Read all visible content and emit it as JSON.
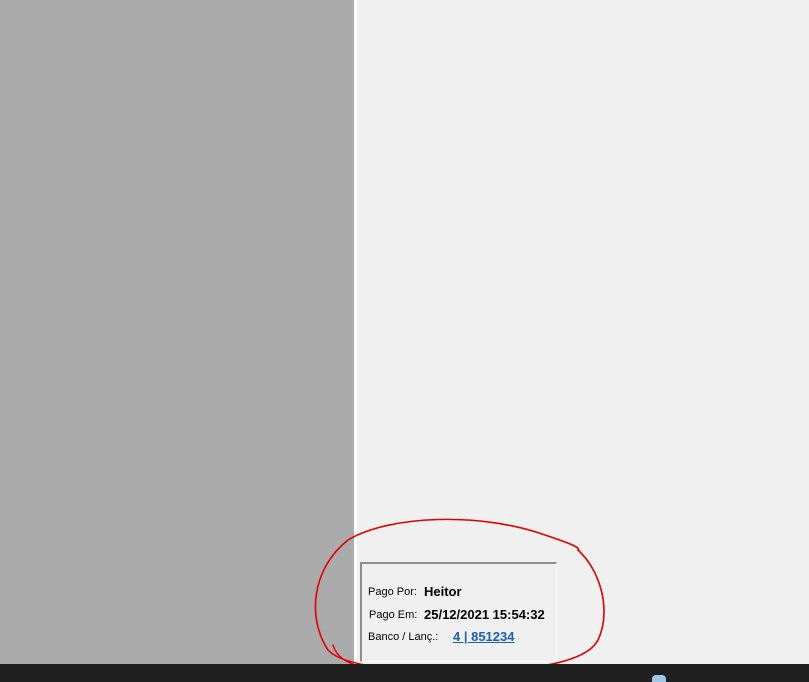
{
  "payment_info": {
    "paid_by_label": "Pago Por:",
    "paid_by_value": "Heitor",
    "paid_at_label": "Pago Em:",
    "paid_at_value": "25/12/2021 15:54:32",
    "bank_label": "Banco / Lanç.:",
    "bank_value": "4 | 851234"
  },
  "colors": {
    "left_pane": "#ababab",
    "right_pane": "#f0f0f0",
    "link": "#1a5fb4",
    "annotation_circle": "#e00000",
    "taskbar": "#1f1f1f"
  },
  "taskbar": {
    "tray_icon": "cloud-icon"
  }
}
